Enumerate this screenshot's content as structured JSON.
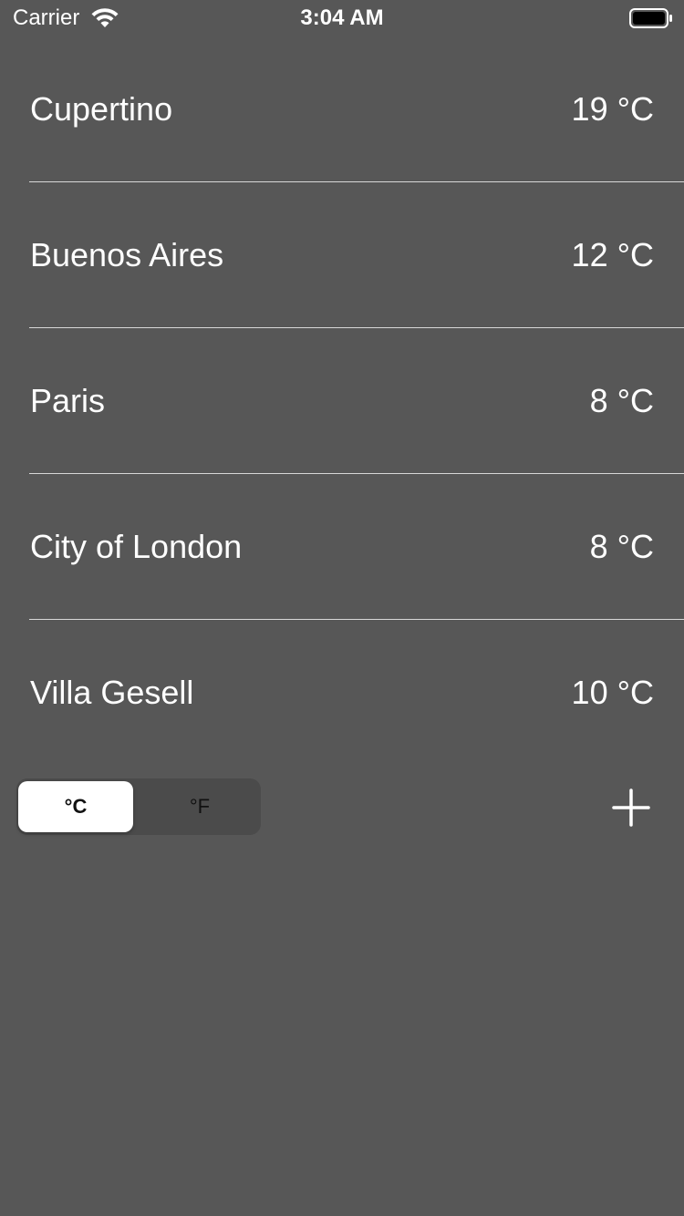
{
  "status_bar": {
    "carrier": "Carrier",
    "time": "3:04 AM"
  },
  "cities": [
    {
      "name": "Cupertino",
      "temperature": "19 °C"
    },
    {
      "name": "Buenos Aires",
      "temperature": "12 °C"
    },
    {
      "name": "Paris",
      "temperature": "8 °C"
    },
    {
      "name": "City of London",
      "temperature": "8 °C"
    },
    {
      "name": "Villa Gesell",
      "temperature": "10 °C"
    }
  ],
  "unit_toggle": {
    "options": [
      "°C",
      "°F"
    ],
    "selected": "°C"
  },
  "icons": {
    "wifi": "wifi-icon",
    "battery": "battery-icon",
    "add": "plus-icon"
  },
  "colors": {
    "background": "#575757",
    "text": "#ffffff",
    "divider": "#d8d8d8",
    "segment_selected": "#ffffff",
    "segment_track": "#4b4b4b"
  }
}
